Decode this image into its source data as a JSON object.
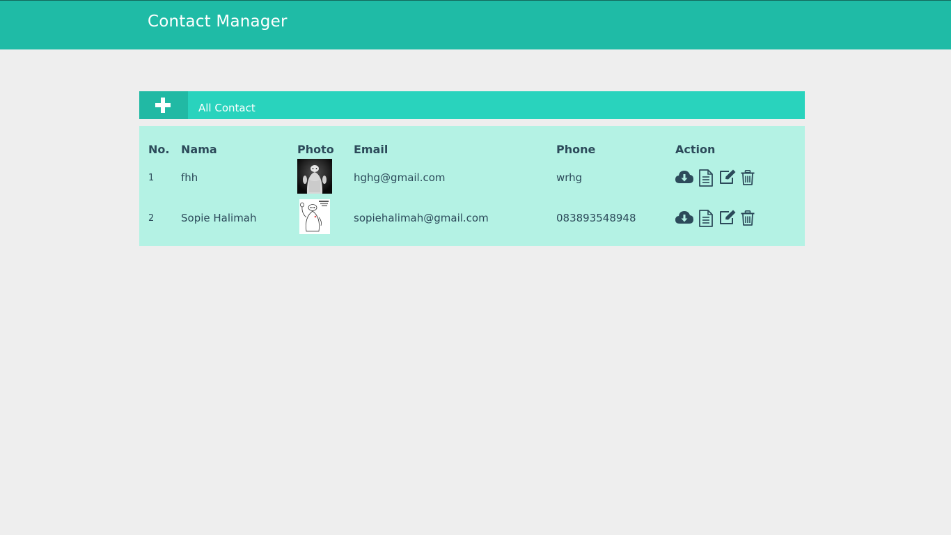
{
  "app": {
    "title": "Contact Manager"
  },
  "panel": {
    "add_icon": "plus-icon",
    "title": "All Contact"
  },
  "table": {
    "headers": {
      "no": "No.",
      "name": "Nama",
      "photo": "Photo",
      "email": "Email",
      "phone": "Phone",
      "action": "Action"
    },
    "rows": [
      {
        "no": "1",
        "name": "fhh",
        "photo": "baymax-dark-photo",
        "email": "hghg@gmail.com",
        "phone": "wrhg",
        "actions": [
          "cloud-download-icon",
          "document-icon",
          "edit-icon",
          "trash-icon"
        ]
      },
      {
        "no": "2",
        "name": "Sopie Halimah",
        "photo": "baymax-waving-photo",
        "email": "sopiehalimah@gmail.com",
        "phone": "083893548948",
        "actions": [
          "cloud-download-icon",
          "document-icon",
          "edit-icon",
          "trash-icon"
        ]
      }
    ]
  },
  "colors": {
    "navbar": "#1fbba6",
    "panel_header": "#29d3bd",
    "add_button": "#21b9a4",
    "table_bg": "#b4f2e4",
    "text": "#2c4a5a",
    "page_bg": "#eeeeee"
  }
}
